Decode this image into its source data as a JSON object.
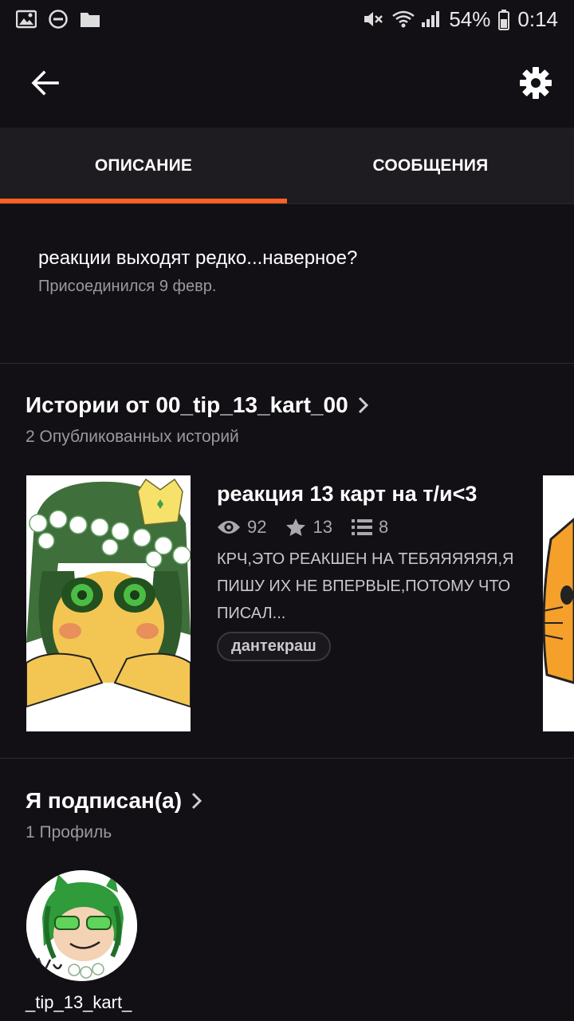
{
  "status_bar": {
    "battery": "54%",
    "time": "0:14",
    "icons": [
      "image-icon",
      "do-not-disturb-icon",
      "folder-icon",
      "mute-icon",
      "wifi-icon",
      "signal-icon",
      "battery-icon"
    ]
  },
  "appbar": {
    "back_icon": "arrow-left-icon",
    "settings_icon": "gear-icon"
  },
  "tabs": [
    {
      "label": "ОПИСАНИЕ",
      "active": true
    },
    {
      "label": "СООБЩЕНИЯ",
      "active": false
    }
  ],
  "accent_color": "#ff6122",
  "about": {
    "description": "реакции выходят редко...наверное?",
    "joined": "Присоединился 9 февр."
  },
  "stories_section": {
    "title": "Истории от 00_tip_13_kart_00",
    "subtitle": "2 Опубликованных историй",
    "stories": [
      {
        "title": "реакция 13 карт на т/и<3",
        "views": "92",
        "votes": "13",
        "parts": "8",
        "description": "КРЧ,ЭТО РЕАКШЕН НА ТЕБЯЯЯЯЯЯ,Я ПИШУ ИХ НЕ ВПЕРВЫЕ,ПОТОМУ ЧТО ПИСАЛ...",
        "tag": "дантекраш"
      }
    ]
  },
  "following_section": {
    "title": "Я подписан(а)",
    "subtitle": "1 Профиль",
    "profiles": [
      {
        "name": "_tip_13_kart_"
      }
    ]
  }
}
